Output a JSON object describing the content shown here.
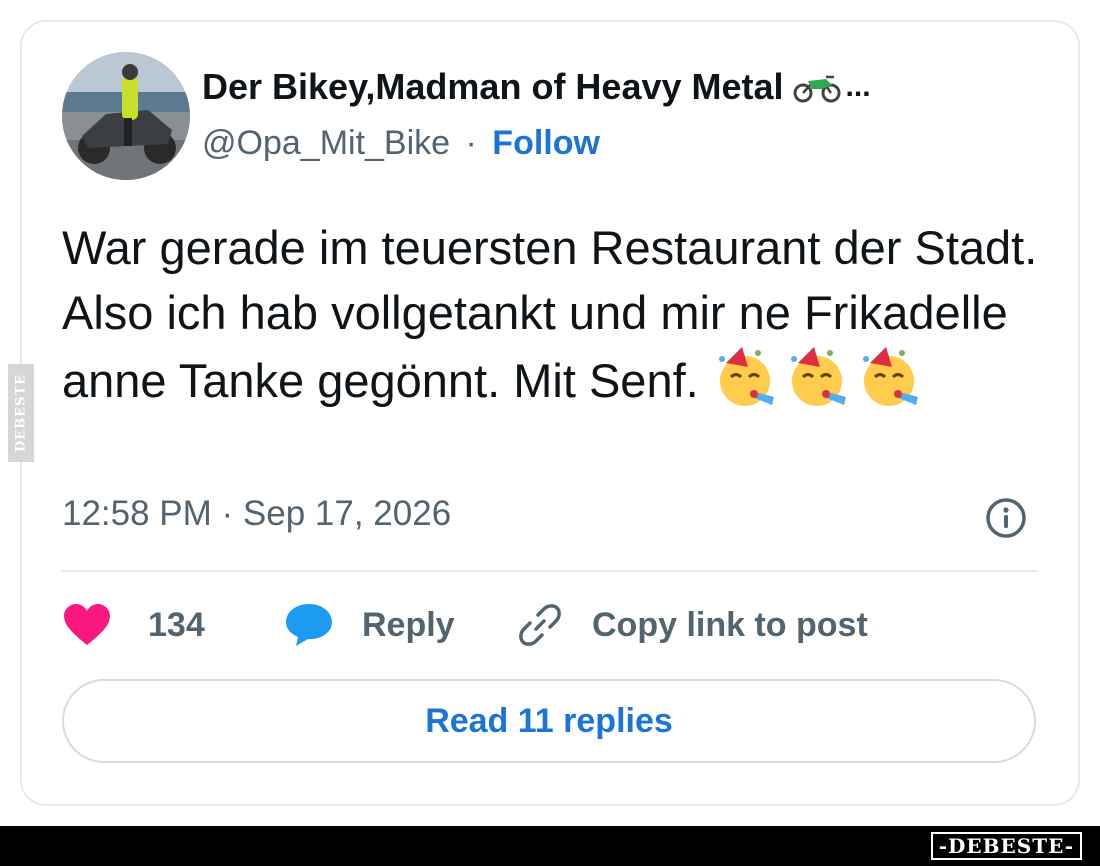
{
  "post": {
    "display_name": "Der Bikey,Madman of Heavy Metal",
    "name_emoji": "motorcycle-icon",
    "name_truncation": "...",
    "handle": "@Opa_Mit_Bike",
    "separator": "·",
    "follow_label": "Follow",
    "text": "War gerade im teuersten Restaurant der Stadt. Also ich hab vollgetankt und mir ne Frikadelle anne Tanke gegönnt. Mit Senf.",
    "emojis": [
      "partying-face-icon",
      "partying-face-icon",
      "partying-face-icon"
    ],
    "timestamp": "12:58 PM · Sep 17, 2026"
  },
  "actions": {
    "like_count": "134",
    "reply_label": "Reply",
    "copy_label": "Copy link to post"
  },
  "read_replies_label": "Read 11 replies",
  "watermark": {
    "side": "DEBESTE",
    "bottom": "-DEBESTE-"
  },
  "colors": {
    "link_blue": "#1d74d7",
    "like_pink": "#f91880",
    "reply_blue": "#1d9bf0",
    "muted": "#536471"
  }
}
